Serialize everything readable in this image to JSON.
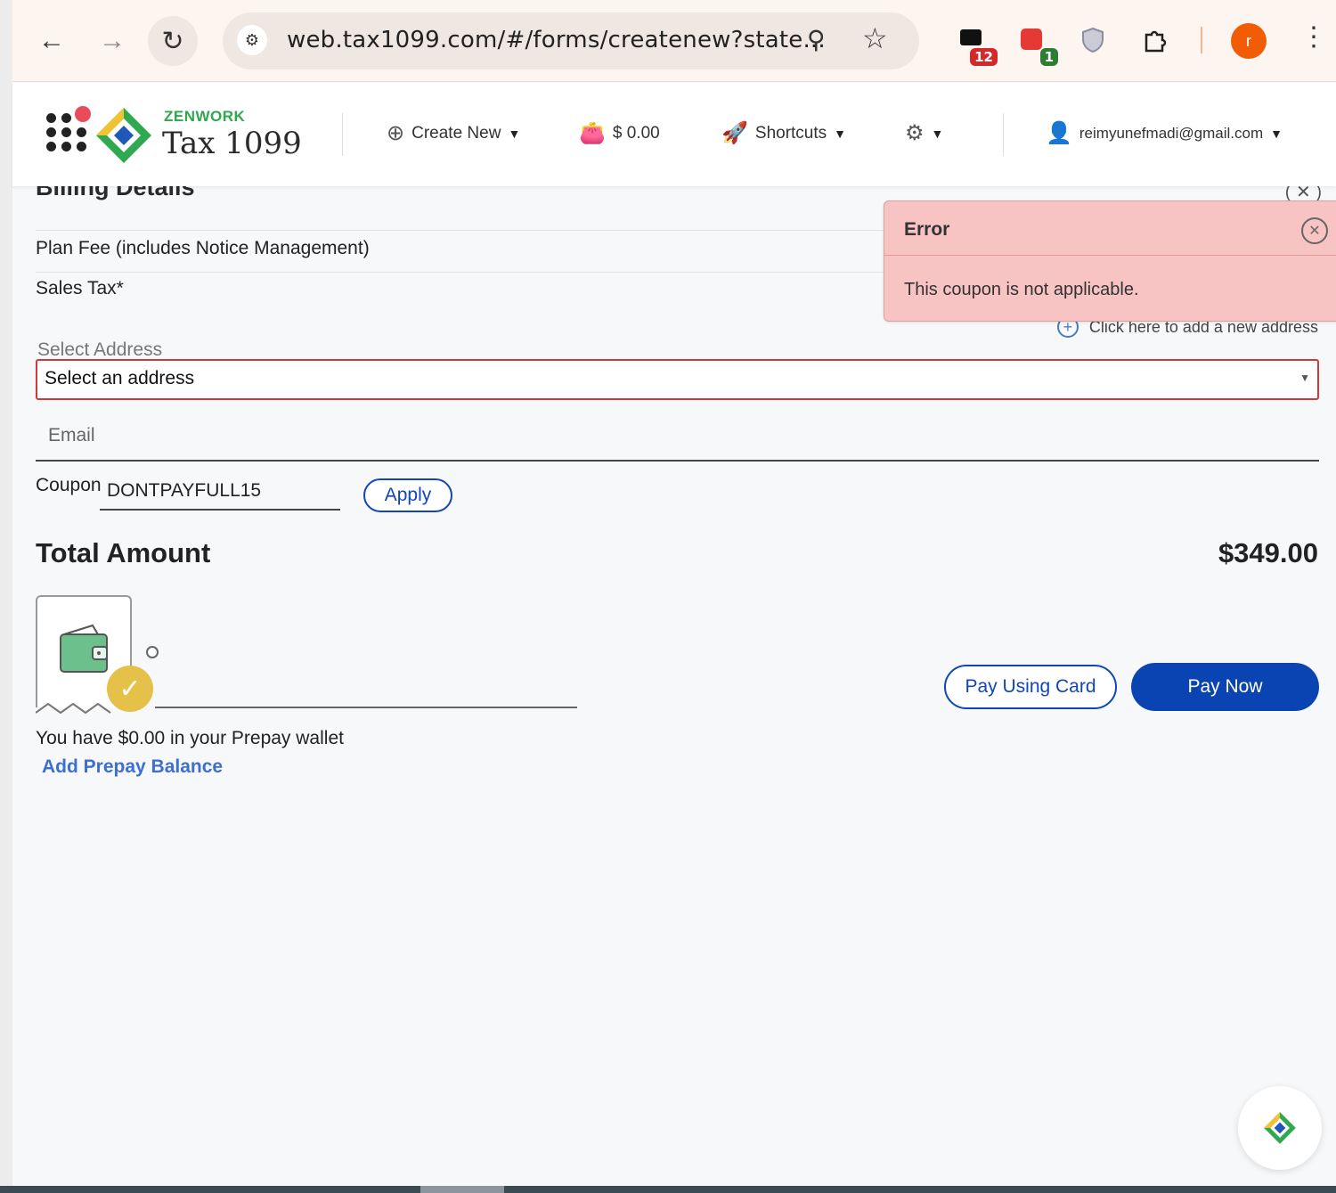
{
  "browser": {
    "url": "web.tax1099.com/#/forms/createnew?state...",
    "extension_badges": {
      "chat": "12",
      "pdf": "1"
    },
    "profile_initial": "r"
  },
  "header": {
    "brand_small": "ZENWORK",
    "brand_big": "Tax 1099",
    "create_new": "Create New",
    "balance": "$ 0.00",
    "shortcuts": "Shortcuts",
    "user_email": "reimyunefmadi@gmail.com"
  },
  "billing": {
    "title": "Billing Details",
    "plan_fee_label": "Plan Fee (includes Notice Management)",
    "sales_tax_label": "Sales Tax*",
    "add_address_link": "Click here to add a new address",
    "select_address_label": "Select Address",
    "select_address_value": "Select an address",
    "email_placeholder": "Email",
    "coupon_label": "Coupon",
    "coupon_value": "DONTPAYFULL15",
    "apply_label": "Apply",
    "total_label": "Total Amount",
    "total_value": "$349.00",
    "wallet_text": "You have $0.00 in your Prepay wallet",
    "add_prepay": "Add Prepay Balance",
    "pay_card": "Pay Using Card",
    "pay_now": "Pay Now"
  },
  "toast": {
    "title": "Error",
    "message": "This coupon is not applicable."
  },
  "colors": {
    "primary": "#0a44b3",
    "error_bg": "#f8c3c3",
    "error_border": "#d23a3a",
    "brand_green": "#2fa84f",
    "profile": "#f25c05"
  }
}
